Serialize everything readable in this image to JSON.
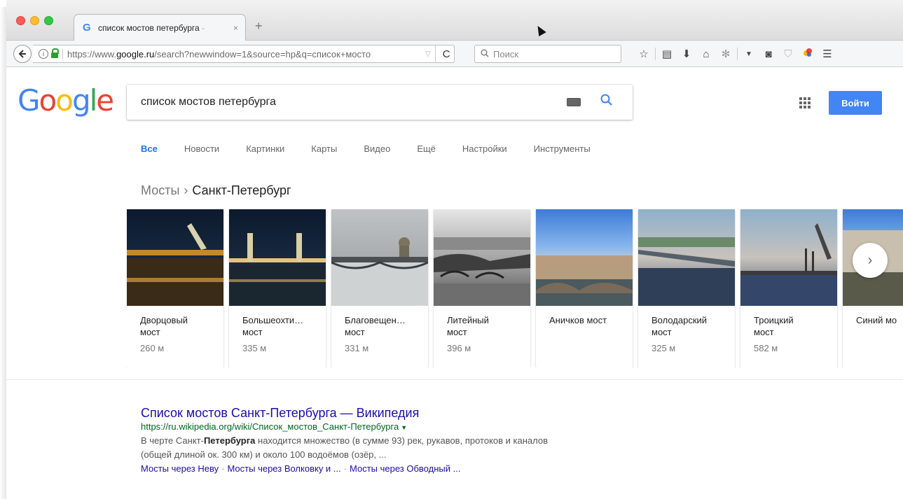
{
  "browser": {
    "tab_title": "список мостов петербурга",
    "tab_title_fade": " - ",
    "tab_close": "×",
    "new_tab": "+",
    "url_prefix": "https://www.",
    "url_domain": "google.ru",
    "url_rest": "/search?newwindow=1&source=hp&q=список+мосто",
    "url_dropdown": "▽",
    "reload": "C",
    "search_placeholder": "Поиск",
    "icons": [
      "bookmark-star-icon",
      "reading-list-icon",
      "download-icon",
      "home-icon",
      "extension-icon",
      "menu-dropdown-icon",
      "pocket-icon",
      "shield-icon",
      "color-icon",
      "hamburger-menu-icon"
    ]
  },
  "google": {
    "logo": [
      "G",
      "o",
      "o",
      "g",
      "l",
      "e"
    ],
    "query": "список мостов петербурга",
    "signin_label": "Войти",
    "tabs": [
      "Все",
      "Новости",
      "Картинки",
      "Карты",
      "Видео",
      "Ещё",
      "Настройки",
      "Инструменты"
    ],
    "kp_parent": "Мосты",
    "kp_chevron": "›",
    "kp_current": "Санкт-Петербург",
    "cards": [
      {
        "name1": "Дворцовый",
        "name2": "мост",
        "dist": "260 м"
      },
      {
        "name1": "Большеохти…",
        "name2": "мост",
        "dist": "335 м"
      },
      {
        "name1": "Благовещен…",
        "name2": "мост",
        "dist": "331 м"
      },
      {
        "name1": "Литейный",
        "name2": "мост",
        "dist": "396 м"
      },
      {
        "name1": "Аничков мост",
        "name2": "",
        "dist": ""
      },
      {
        "name1": "Володарский",
        "name2": "мост",
        "dist": "325 м"
      },
      {
        "name1": "Троицкий",
        "name2": "мост",
        "dist": "582 м"
      },
      {
        "name1": "Синий мо",
        "name2": "",
        "dist": ""
      }
    ],
    "next": "›",
    "result": {
      "title": "Список мостов Санкт-Петербурга — Википедия",
      "url": "https://ru.wikipedia.org/wiki/Список_мостов_Санкт-Петербурга",
      "url_arrow": "▼",
      "snip_a": "В черте Санкт-",
      "snip_bold": "Петербурга",
      "snip_b": " находится множество (в сумме 93) рек, рукавов, протоков и каналов",
      "snip_line2": "(общей длиной ок. 300 км) и около 100 водоёмов (озёр, ...",
      "links": [
        "Мосты через Неву",
        "Мосты через Волковку и ...",
        "Мосты через Обводный ..."
      ],
      "link_sep": "·"
    }
  }
}
